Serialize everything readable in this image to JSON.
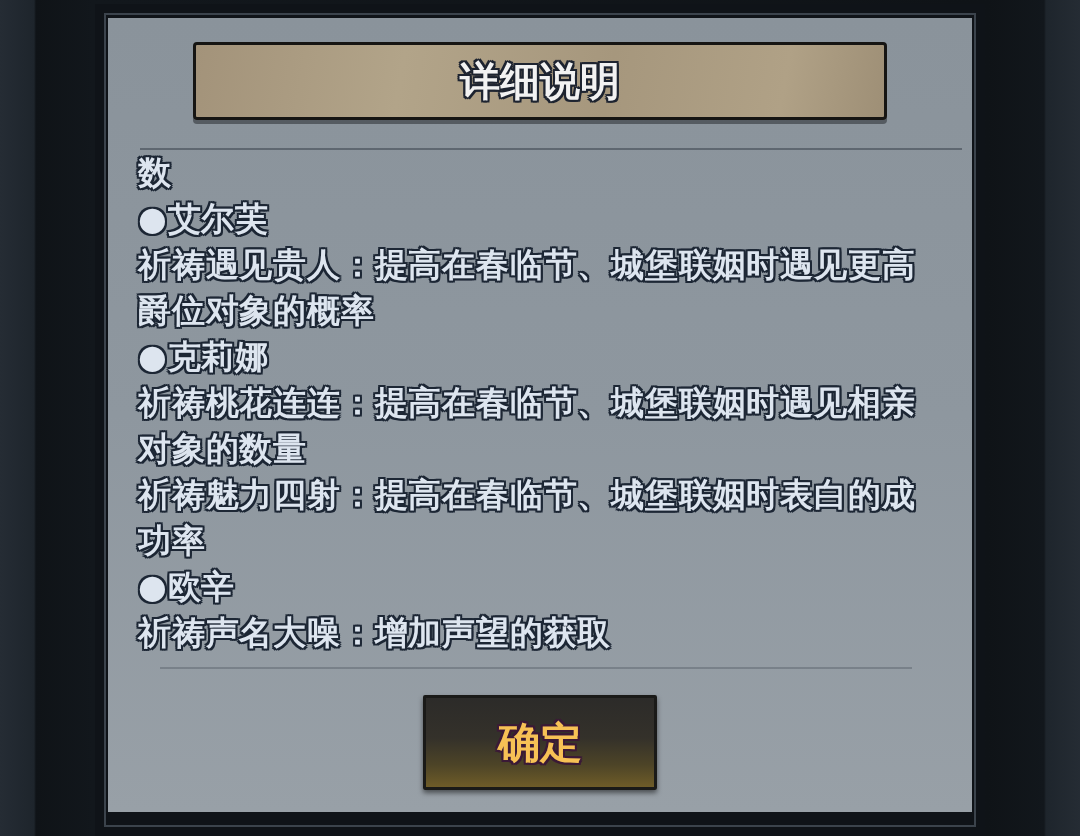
{
  "dialog": {
    "title": "详细说明"
  },
  "content": {
    "cut_text": "数",
    "sections": [
      {
        "name": "●艾尔芙",
        "effects": [
          "祈祷遇见贵人：提高在春临节、城堡联姻时遇见更高爵位对象的概率"
        ]
      },
      {
        "name": "●克莉娜",
        "effects": [
          "祈祷桃花连连：提高在春临节、城堡联姻时遇见相亲对象的数量",
          "祈祷魅力四射：提高在春临节、城堡联姻时表白的成功率"
        ]
      },
      {
        "name": "●欧辛",
        "effects": [
          "祈祷声名大噪：增加声望的获取"
        ]
      }
    ]
  },
  "confirm_button": {
    "label": "确定"
  }
}
